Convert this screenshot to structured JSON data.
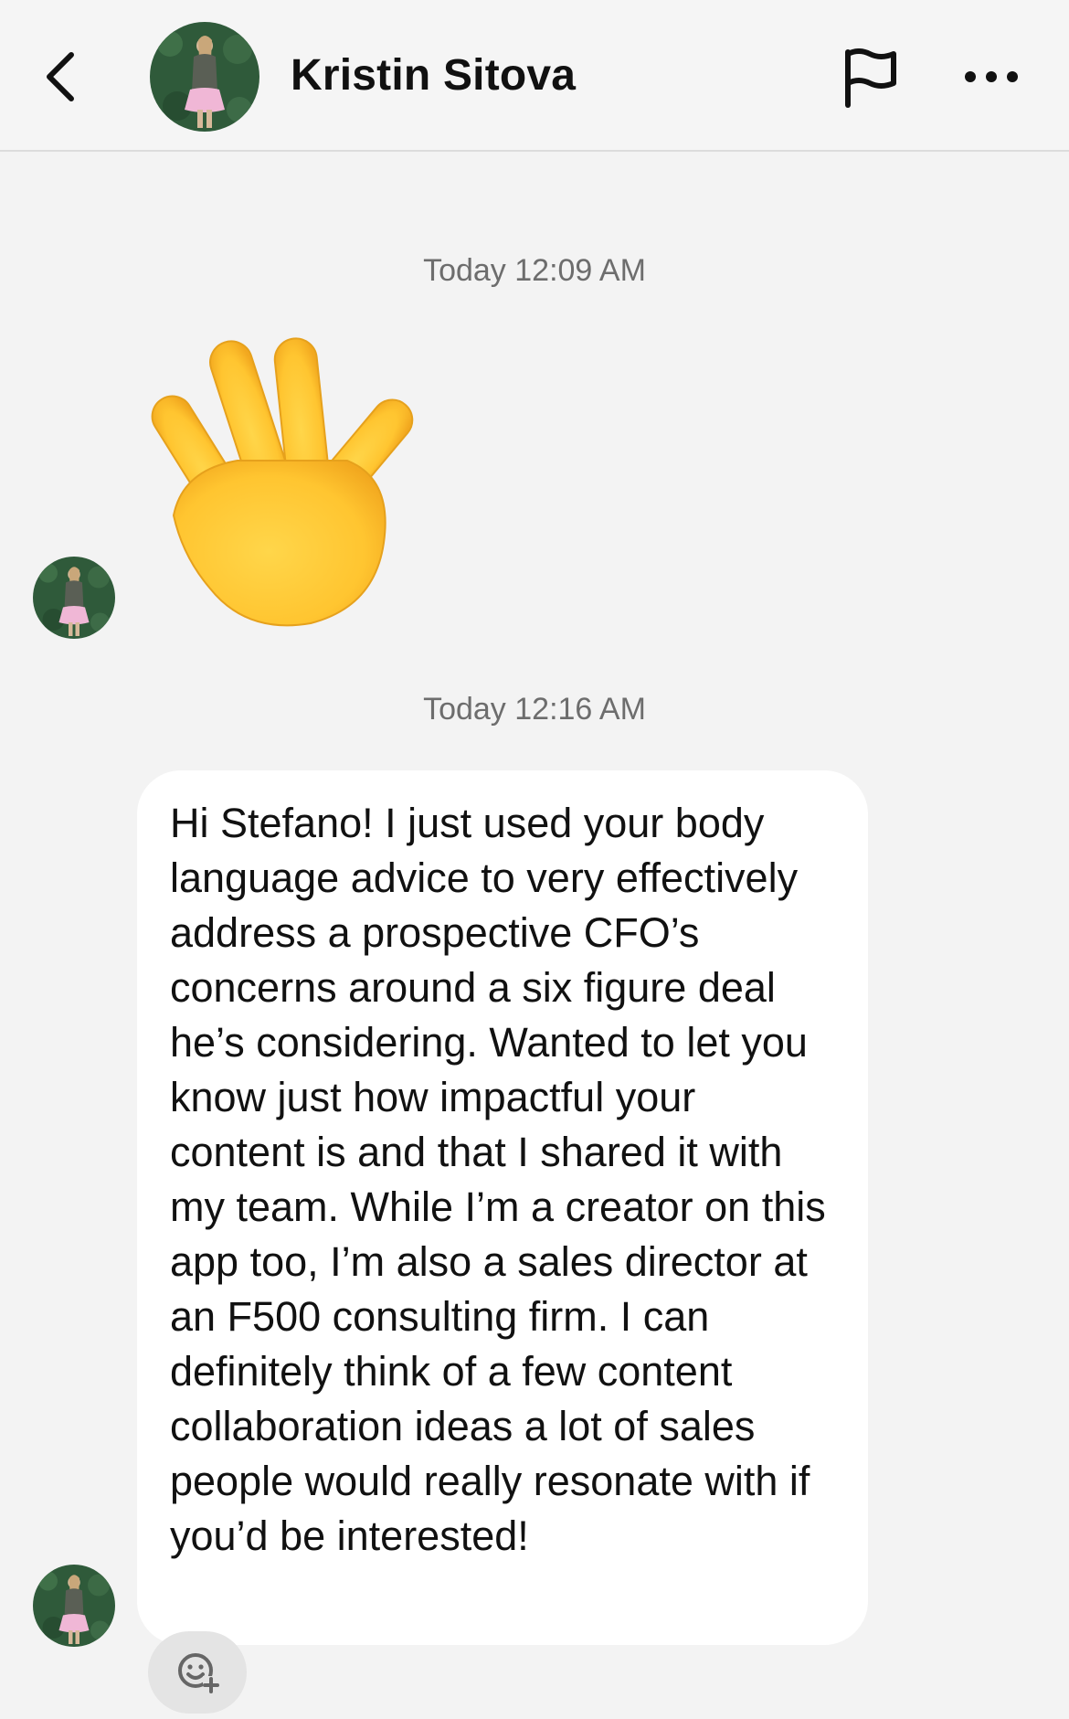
{
  "header": {
    "name": "Kristin Sitova",
    "back_icon": "chevron-left-icon",
    "flag_icon": "flag-icon",
    "more_icon": "more-horizontal-icon"
  },
  "conversation": {
    "messages": [
      {
        "timestamp": "Today 12:09 AM",
        "type": "emoji",
        "emoji_name": "waving-hand"
      },
      {
        "timestamp": "Today 12:16 AM",
        "type": "text",
        "text": "Hi Stefano! I just used your body language advice to very effectively address a prospective CFO’s concerns around a six figure deal he’s considering. Wanted to let you know just how impactful your content is and that I shared it with my team. While I’m a creator on this app too, I’m also a sales director at an F500 consulting firm. I can definitely think of a few content collaboration ideas a lot of sales people would really resonate with if you’d be interested!"
      }
    ]
  },
  "reaction_button_icon": "add-reaction-icon",
  "colors": {
    "background": "#f3f3f3",
    "bubble": "#ffffff",
    "emoji_yellow": "#ffc83d",
    "timestamp": "#6d6d6d"
  }
}
